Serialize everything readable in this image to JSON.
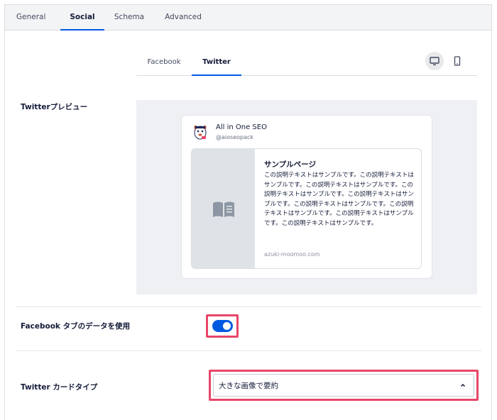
{
  "main_tabs": [
    {
      "label": "General"
    },
    {
      "label": "Social"
    },
    {
      "label": "Schema"
    },
    {
      "label": "Advanced"
    }
  ],
  "active_main_tab": "Social",
  "sub_tabs": [
    {
      "label": "Facebook"
    },
    {
      "label": "Twitter"
    }
  ],
  "active_sub_tab": "Twitter",
  "device_icons": [
    "desktop-icon",
    "mobile-icon"
  ],
  "preview": {
    "label": "Twitterプレビュー",
    "account_name": "All in One SEO",
    "account_handle": "@aioseopack",
    "card_title": "サンプルページ",
    "card_description": "この説明テキストはサンプルです。この説明テキストはサンプルです。この説明テキストはサンプルです。この説明テキストはサンプルです。この説明テキストはサンプルです。この説明テキストはサンプルです。この説明テキストはサンプルです。この説明テキストはサンプルです。この説明テキストはサンプルです。",
    "card_domain": "azuki-moomoo.com",
    "image_placeholder_icon": "book-icon"
  },
  "use_facebook_data": {
    "label": "Facebook タブのデータを使用",
    "enabled": true
  },
  "card_type": {
    "label": "Twitter カードタイプ",
    "value": "大きな画像で要約"
  },
  "colors": {
    "accent": "#005ae0",
    "highlight": "#e8466a",
    "preview_bg": "#eef0f4"
  }
}
